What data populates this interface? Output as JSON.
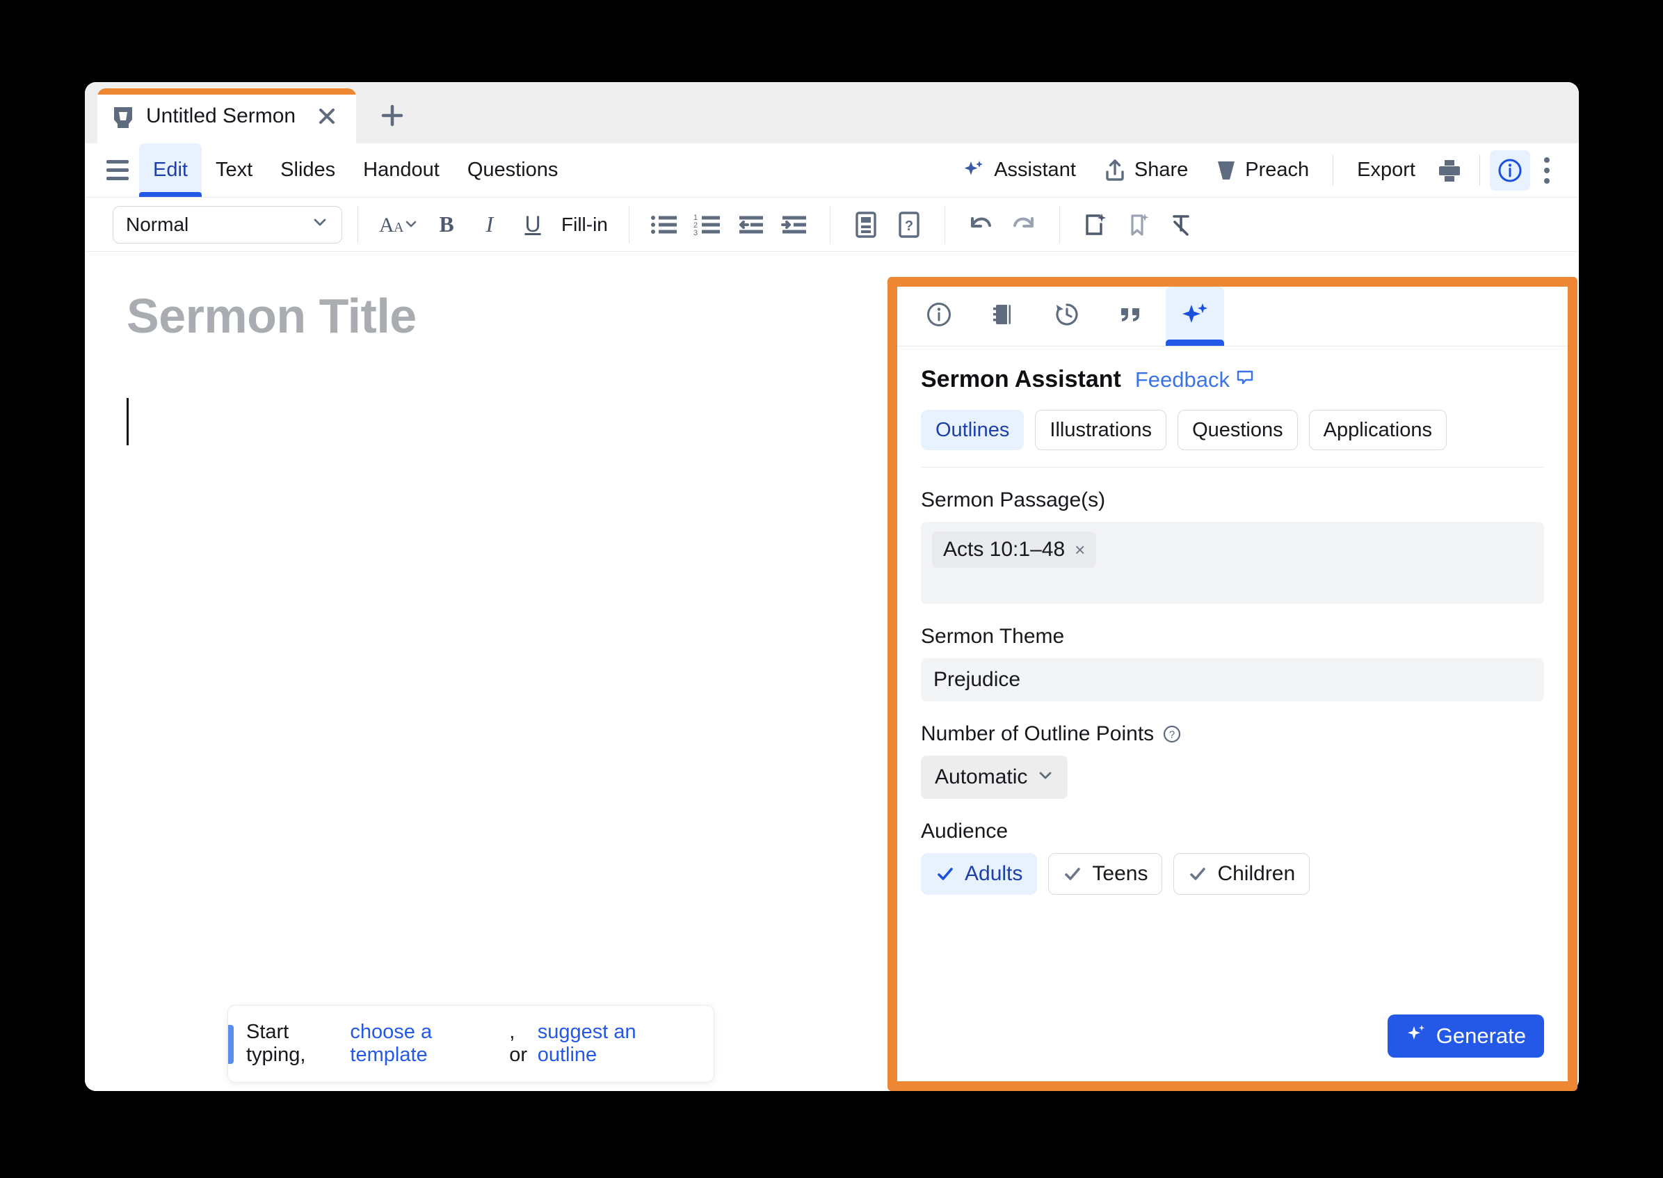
{
  "window": {
    "accent_color": "#ed8733",
    "tab": {
      "title": "Untitled Sermon",
      "favicon": "pulpit-icon",
      "close": "×",
      "new_tab": "+"
    }
  },
  "menubar": {
    "hamburger": "menu-icon",
    "items": [
      {
        "label": "Edit",
        "active": true
      },
      {
        "label": "Text",
        "active": false
      },
      {
        "label": "Slides",
        "active": false
      },
      {
        "label": "Handout",
        "active": false
      },
      {
        "label": "Questions",
        "active": false
      }
    ],
    "tools": [
      {
        "label": "Assistant",
        "icon": "sparkle-icon"
      },
      {
        "label": "Share",
        "icon": "share-upload-icon"
      },
      {
        "label": "Preach",
        "icon": "megaphone-icon"
      },
      {
        "label": "Export",
        "icon": null
      }
    ],
    "print_icon": "printer-icon",
    "info_icon": "info-circle-icon",
    "more_icon": "kebab-menu-icon"
  },
  "formatbar": {
    "style": {
      "value": "Normal",
      "caret": "chevron-down-icon"
    },
    "text_tools": [
      {
        "name": "font-size-icon",
        "label": "Aa"
      },
      {
        "name": "bold-icon",
        "label": "B"
      },
      {
        "name": "italic-icon",
        "label": "I"
      },
      {
        "name": "underline-icon",
        "label": "U"
      },
      {
        "name": "fill-in-button",
        "label": "Fill-in"
      }
    ],
    "list_tools": [
      "bulleted-list-icon",
      "numbered-list-icon",
      "outdent-icon",
      "indent-icon"
    ],
    "insert_tools": [
      "note-card-icon",
      "question-card-icon"
    ],
    "history_tools": [
      "undo-icon",
      "redo-icon"
    ],
    "ai_tools": [
      "ai-slide-icon",
      "ai-bookmark-icon",
      "clear-formatting-icon"
    ]
  },
  "document": {
    "title_placeholder": "Sermon Title",
    "hint": {
      "prefix": "Start typing, ",
      "link1": "choose a template",
      "middle": ", or ",
      "link2": "suggest an outline"
    }
  },
  "assistant": {
    "panel_tabs": [
      {
        "icon": "info-circle-icon",
        "active": false
      },
      {
        "icon": "notebook-icon",
        "active": false
      },
      {
        "icon": "history-clock-icon",
        "active": false
      },
      {
        "icon": "quote-icon",
        "active": false
      },
      {
        "icon": "sparkle-icon",
        "active": true
      }
    ],
    "title": "Sermon Assistant",
    "feedback": {
      "label": "Feedback",
      "icon": "speech-bubble-icon"
    },
    "categories": [
      {
        "label": "Outlines",
        "active": true
      },
      {
        "label": "Illustrations",
        "active": false
      },
      {
        "label": "Questions",
        "active": false
      },
      {
        "label": "Applications",
        "active": false
      }
    ],
    "passage_field": {
      "label": "Sermon Passage(s)",
      "chips": [
        {
          "text": "Acts 10:1–48",
          "remove": "×"
        }
      ]
    },
    "theme_field": {
      "label": "Sermon Theme",
      "value": "Prejudice"
    },
    "points_field": {
      "label": "Number of Outline Points",
      "help_icon": "help-circle-icon",
      "value": "Automatic",
      "caret": "chevron-down-icon"
    },
    "audience_field": {
      "label": "Audience",
      "options": [
        {
          "label": "Adults",
          "selected": true
        },
        {
          "label": "Teens",
          "selected": false
        },
        {
          "label": "Children",
          "selected": false
        }
      ]
    },
    "generate_button": {
      "label": "Generate",
      "icon": "sparkle-icon"
    }
  }
}
